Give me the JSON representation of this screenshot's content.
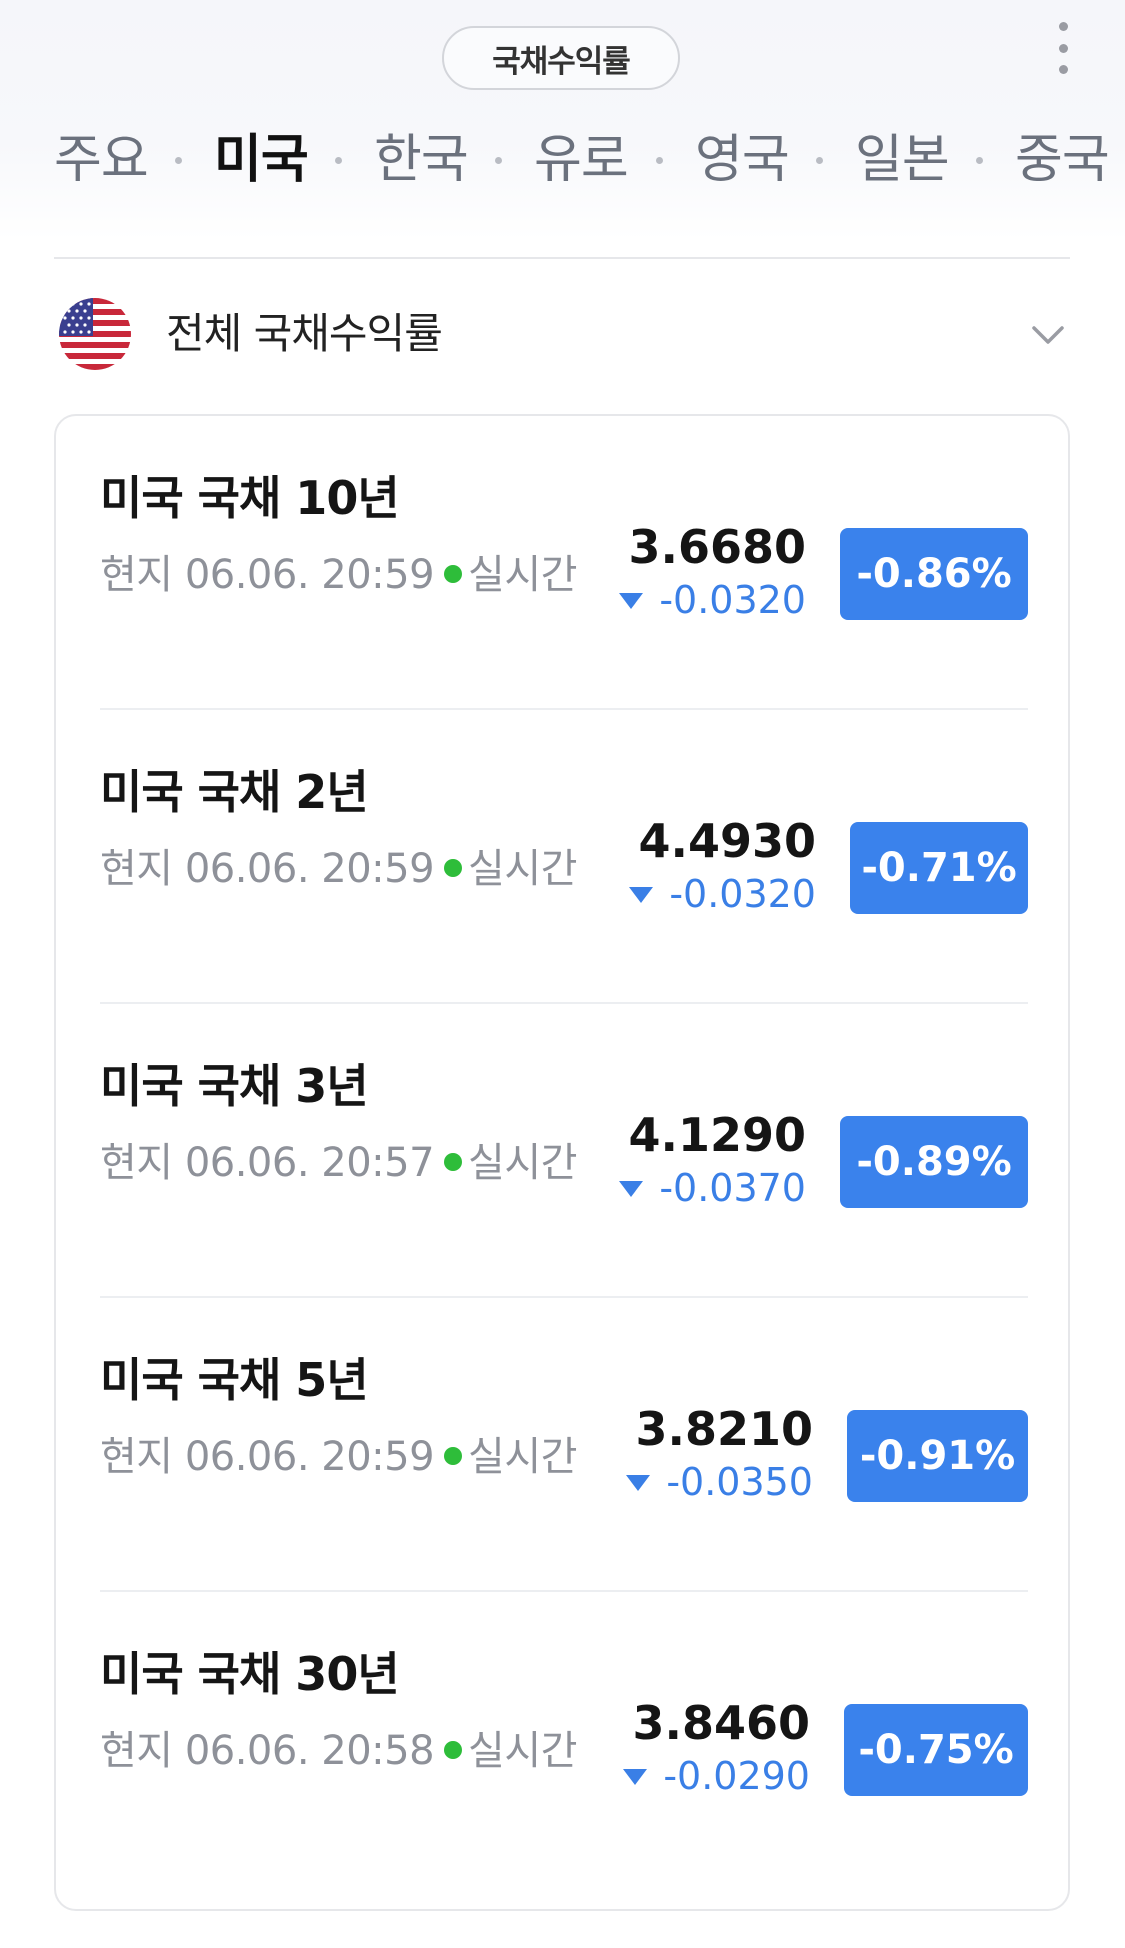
{
  "header": {
    "title": "국채수익률",
    "tabs": [
      {
        "label": "주요",
        "active": false
      },
      {
        "label": "미국",
        "active": true
      },
      {
        "label": "한국",
        "active": false
      },
      {
        "label": "유로",
        "active": false
      },
      {
        "label": "영국",
        "active": false
      },
      {
        "label": "일본",
        "active": false
      },
      {
        "label": "중국",
        "active": false
      }
    ]
  },
  "section": {
    "title": "전체 국채수익률",
    "flag_icon": "us-flag-icon"
  },
  "rows": [
    {
      "name": "미국 국채 10년",
      "time": "현지 06.06. 20:59",
      "live": "실시간",
      "value": "3.6680",
      "change": "-0.0320",
      "rate": "-0.86%"
    },
    {
      "name": "미국 국채 2년",
      "time": "현지 06.06. 20:59",
      "live": "실시간",
      "value": "4.4930",
      "change": "-0.0320",
      "rate": "-0.71%"
    },
    {
      "name": "미국 국채 3년",
      "time": "현지 06.06. 20:57",
      "live": "실시간",
      "value": "4.1290",
      "change": "-0.0370",
      "rate": "-0.89%"
    },
    {
      "name": "미국 국채 5년",
      "time": "현지 06.06. 20:59",
      "live": "실시간",
      "value": "3.8210",
      "change": "-0.0350",
      "rate": "-0.91%"
    },
    {
      "name": "미국 국채 30년",
      "time": "현지 06.06. 20:58",
      "live": "실시간",
      "value": "3.8460",
      "change": "-0.0290",
      "rate": "-0.75%"
    }
  ],
  "colors": {
    "accent_blue": "#3a82ec",
    "change_blue": "#3a7fe6",
    "live_green": "#2ebd3a"
  }
}
